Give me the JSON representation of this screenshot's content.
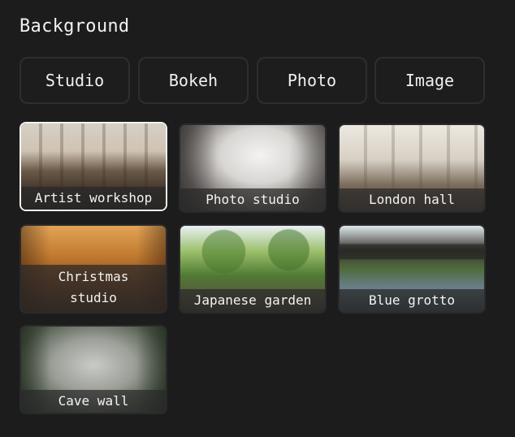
{
  "panel": {
    "title": "Background"
  },
  "tabs": [
    {
      "label": "Studio"
    },
    {
      "label": "Bokeh"
    },
    {
      "label": "Photo"
    },
    {
      "label": "Image"
    }
  ],
  "backgrounds": [
    {
      "label": "Artist workshop",
      "selected": true
    },
    {
      "label": "Photo studio",
      "selected": false
    },
    {
      "label": "London hall",
      "selected": false
    },
    {
      "label": "Christmas\nstudio",
      "selected": false
    },
    {
      "label": "Japanese garden",
      "selected": false
    },
    {
      "label": "Blue grotto",
      "selected": false
    },
    {
      "label": "Cave wall",
      "selected": false
    }
  ]
}
